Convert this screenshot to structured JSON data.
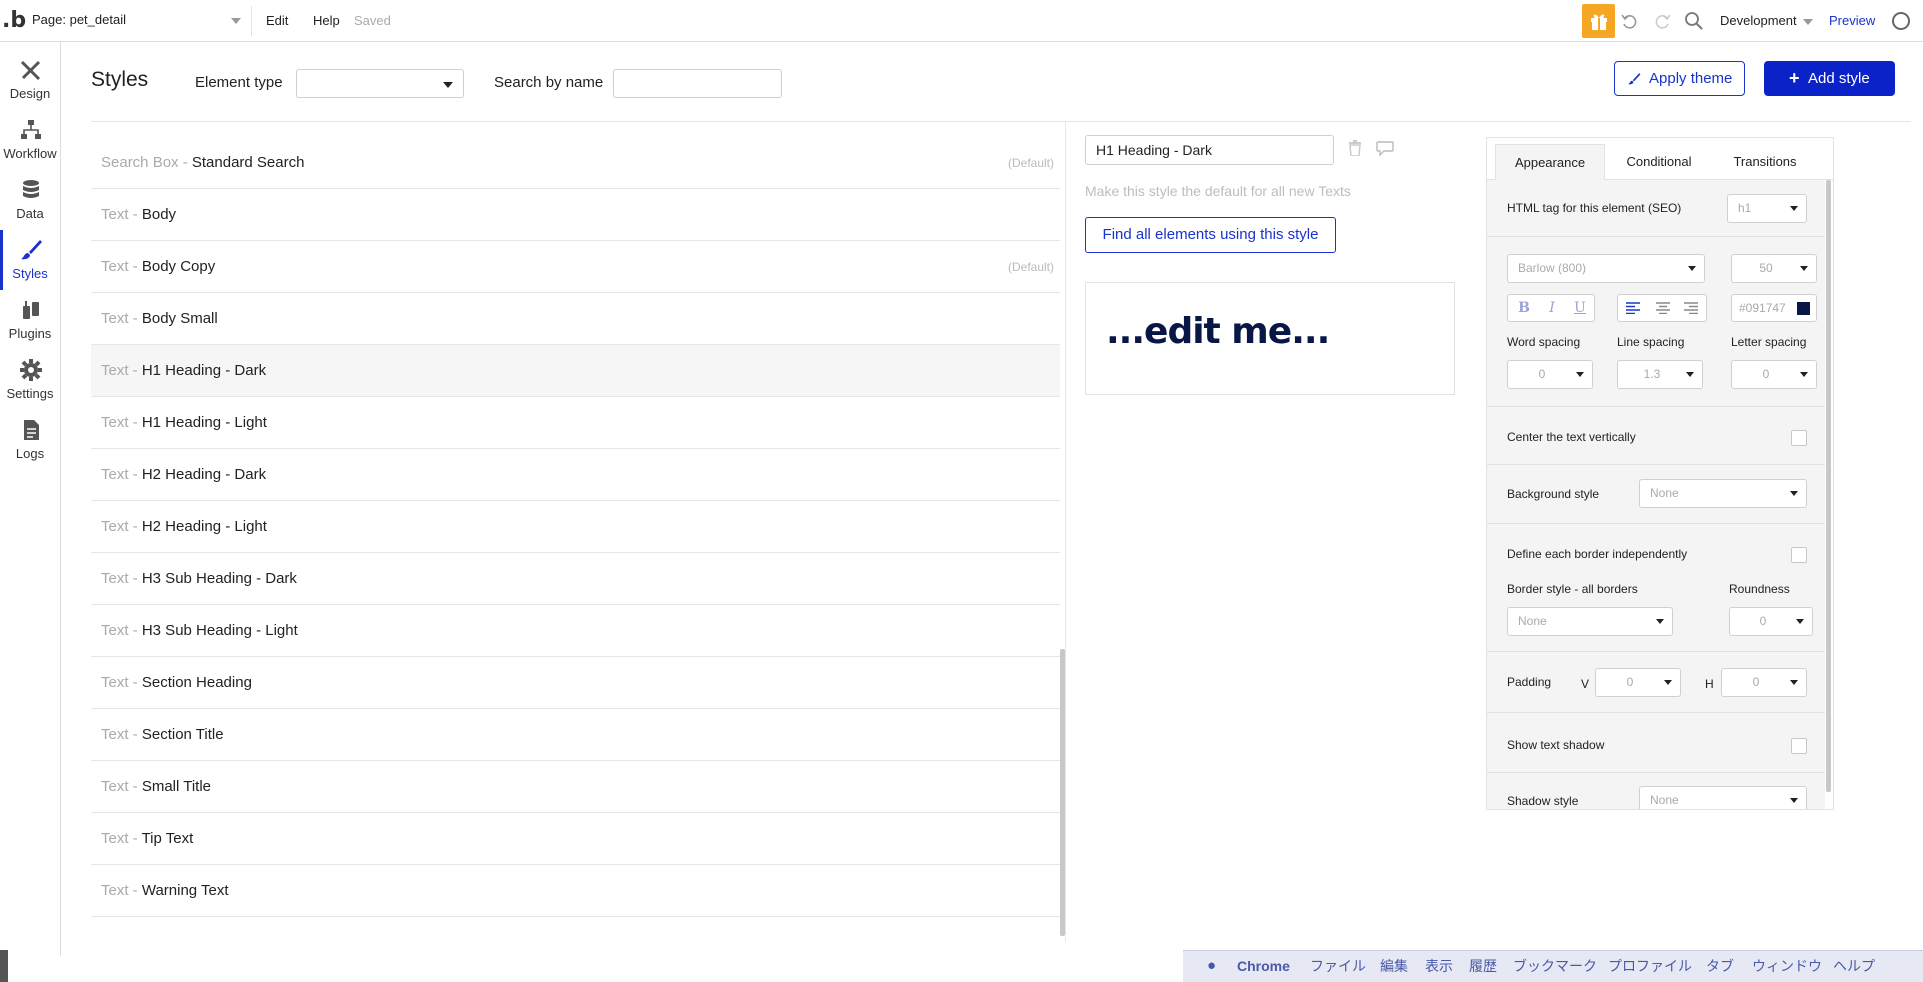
{
  "topbar": {
    "page_label": "Page: pet_detail",
    "menu_edit": "Edit",
    "menu_help": "Help",
    "saved_status": "Saved",
    "environment": "Development",
    "preview_label": "Preview"
  },
  "nav": {
    "items": [
      {
        "label": "Design",
        "icon": "design-icon"
      },
      {
        "label": "Workflow",
        "icon": "workflow-icon"
      },
      {
        "label": "Data",
        "icon": "data-icon"
      },
      {
        "label": "Styles",
        "icon": "brush-icon",
        "active": true
      },
      {
        "label": "Plugins",
        "icon": "plugin-icon"
      },
      {
        "label": "Settings",
        "icon": "gear-icon"
      },
      {
        "label": "Logs",
        "icon": "logs-icon"
      }
    ]
  },
  "header": {
    "title": "Styles",
    "element_type_label": "Element type",
    "element_type_value": "",
    "search_label": "Search by name",
    "search_value": "",
    "apply_theme": "Apply theme",
    "add_style": "Add style"
  },
  "styles": [
    {
      "type": "Search Box - ",
      "name": "Standard Search",
      "default": "(Default)"
    },
    {
      "type": "Text - ",
      "name": "Body",
      "default": ""
    },
    {
      "type": "Text - ",
      "name": "Body Copy",
      "default": "(Default)"
    },
    {
      "type": "Text - ",
      "name": "Body Small",
      "default": ""
    },
    {
      "type": "Text - ",
      "name": "H1 Heading - Dark",
      "default": ""
    },
    {
      "type": "Text - ",
      "name": "H1 Heading - Light",
      "default": ""
    },
    {
      "type": "Text - ",
      "name": "H2 Heading - Dark",
      "default": ""
    },
    {
      "type": "Text - ",
      "name": "H2 Heading - Light",
      "default": ""
    },
    {
      "type": "Text - ",
      "name": "H3 Sub Heading - Dark",
      "default": ""
    },
    {
      "type": "Text - ",
      "name": "H3 Sub Heading - Light",
      "default": ""
    },
    {
      "type": "Text - ",
      "name": "Section Heading",
      "default": ""
    },
    {
      "type": "Text - ",
      "name": "Section Title",
      "default": ""
    },
    {
      "type": "Text - ",
      "name": "Small Title",
      "default": ""
    },
    {
      "type": "Text - ",
      "name": "Tip Text",
      "default": ""
    },
    {
      "type": "Text - ",
      "name": "Warning Text",
      "default": ""
    }
  ],
  "selected_style": "H1 Heading - Dark",
  "editor": {
    "style_name": "H1 Heading - Dark",
    "default_note": "Make this style the default for all new Texts",
    "find_button": "Find all elements using this style",
    "preview_text": "...edit me..."
  },
  "panel": {
    "tabs": [
      "Appearance",
      "Conditional",
      "Transitions"
    ],
    "active_tab": "Appearance",
    "html_tag_label": "HTML tag for this element (SEO)",
    "html_tag_value": "h1",
    "font_value": "Barlow (800)",
    "font_size_value": "50",
    "bold_glyph": "B",
    "italic_glyph": "I",
    "underline_glyph": "U",
    "color_value": "#091747",
    "word_spacing_label": "Word spacing",
    "line_spacing_label": "Line spacing",
    "letter_spacing_label": "Letter spacing",
    "word_spacing_value": "0",
    "line_spacing_value": "1.3",
    "letter_spacing_value": "0",
    "center_vertical_label": "Center the text vertically",
    "background_style_label": "Background style",
    "background_style_value": "None",
    "border_independent_label": "Define each border independently",
    "border_style_label": "Border style - all borders",
    "border_style_value": "None",
    "roundness_label": "Roundness",
    "roundness_value": "0",
    "padding_label": "Padding",
    "padding_v_label": "V",
    "padding_v_value": "0",
    "padding_h_label": "H",
    "padding_h_value": "0",
    "text_shadow_label": "Show text shadow",
    "shadow_style_label": "Shadow style",
    "shadow_style_value": "None"
  },
  "macbar": {
    "app": "Chrome",
    "menus": [
      "ファイル",
      "編集",
      "表示",
      "履歴",
      "ブックマーク",
      "プロファイル",
      "タブ",
      "ウィンドウ",
      "ヘルプ"
    ]
  },
  "colors": {
    "accent": "#1a33cc",
    "add_button": "#0b22c9",
    "gift": "#f5a623",
    "text_color": "#091747"
  }
}
